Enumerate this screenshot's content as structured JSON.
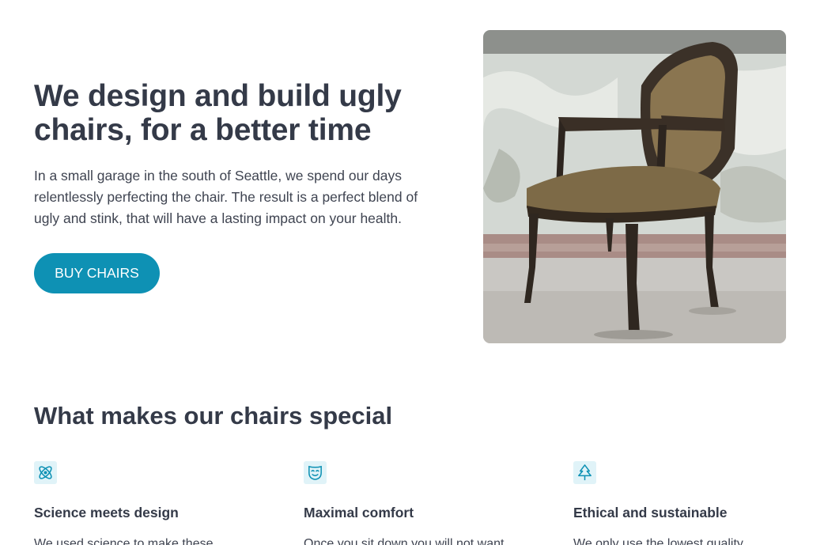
{
  "hero": {
    "title": "We design and build ugly chairs, for a better time",
    "text": "In a small garage in the south of Seattle, we spend our days relentlessly perfecting the chair. The result is a perfect blend of ugly and stink, that will have a lasting impact on your health.",
    "button_label": "BUY CHAIRS",
    "image_alt": "old-chair-photo"
  },
  "features": {
    "title": "What makes our chairs special",
    "items": [
      {
        "icon": "atom-icon",
        "title": "Science meets design",
        "text": "We used science to make these"
      },
      {
        "icon": "mask-icon",
        "title": "Maximal comfort",
        "text": "Once you sit down you will not want"
      },
      {
        "icon": "tree-icon",
        "title": "Ethical and sustainable",
        "text": "We only use the lowest quality"
      }
    ]
  },
  "colors": {
    "accent": "#0e91b4",
    "heading": "#343a48",
    "icon_bg": "#e0f3f8"
  }
}
